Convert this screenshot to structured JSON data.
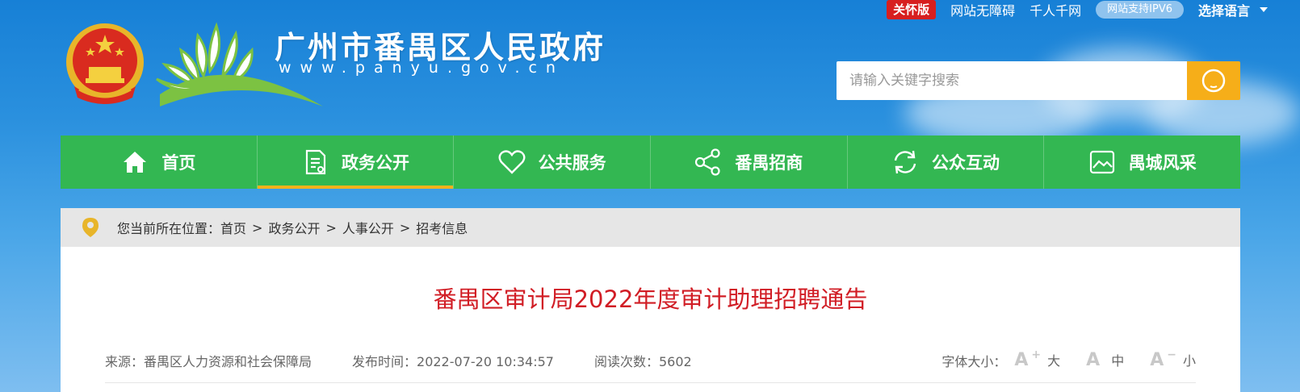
{
  "topbar": {
    "care_mode": "关怀版",
    "accessible": "网站无障碍",
    "lang_trad": "千人千网",
    "ipv6": "网站支持IPV6",
    "language": "选择语言"
  },
  "header": {
    "site_title": "广州市番禺区人民政府",
    "site_url": "www.panyu.gov.cn"
  },
  "search": {
    "placeholder": "请输入关键字搜索"
  },
  "nav": {
    "items": [
      {
        "label": "首页",
        "icon": "home-icon"
      },
      {
        "label": "政务公开",
        "icon": "document-icon"
      },
      {
        "label": "公共服务",
        "icon": "heart-icon"
      },
      {
        "label": "番禺招商",
        "icon": "share-icon"
      },
      {
        "label": "公众互动",
        "icon": "refresh-icon"
      },
      {
        "label": "禺城风采",
        "icon": "image-icon"
      }
    ],
    "active_index": 1
  },
  "breadcrumb": {
    "prefix": "您当前所在位置：",
    "items": [
      "首页",
      "政务公开",
      "人事公开",
      "招考信息"
    ],
    "separator": ">"
  },
  "article": {
    "title": "番禺区审计局2022年度审计助理招聘通告",
    "source": "来源：番禺区人力资源和社会保障局",
    "published": "发布时间：2022-07-20 10:34:57",
    "views": "阅读次数：5602",
    "font_size_label": "字体大小：",
    "font_large": "大",
    "font_medium": "中",
    "font_small": "小",
    "font_glyph": "A",
    "font_plus": "+",
    "font_minus": "−"
  },
  "colors": {
    "nav_green": "#33b752",
    "accent_orange": "#f6ae19",
    "title_red": "#d11d25",
    "care_red": "#d71f1f"
  }
}
